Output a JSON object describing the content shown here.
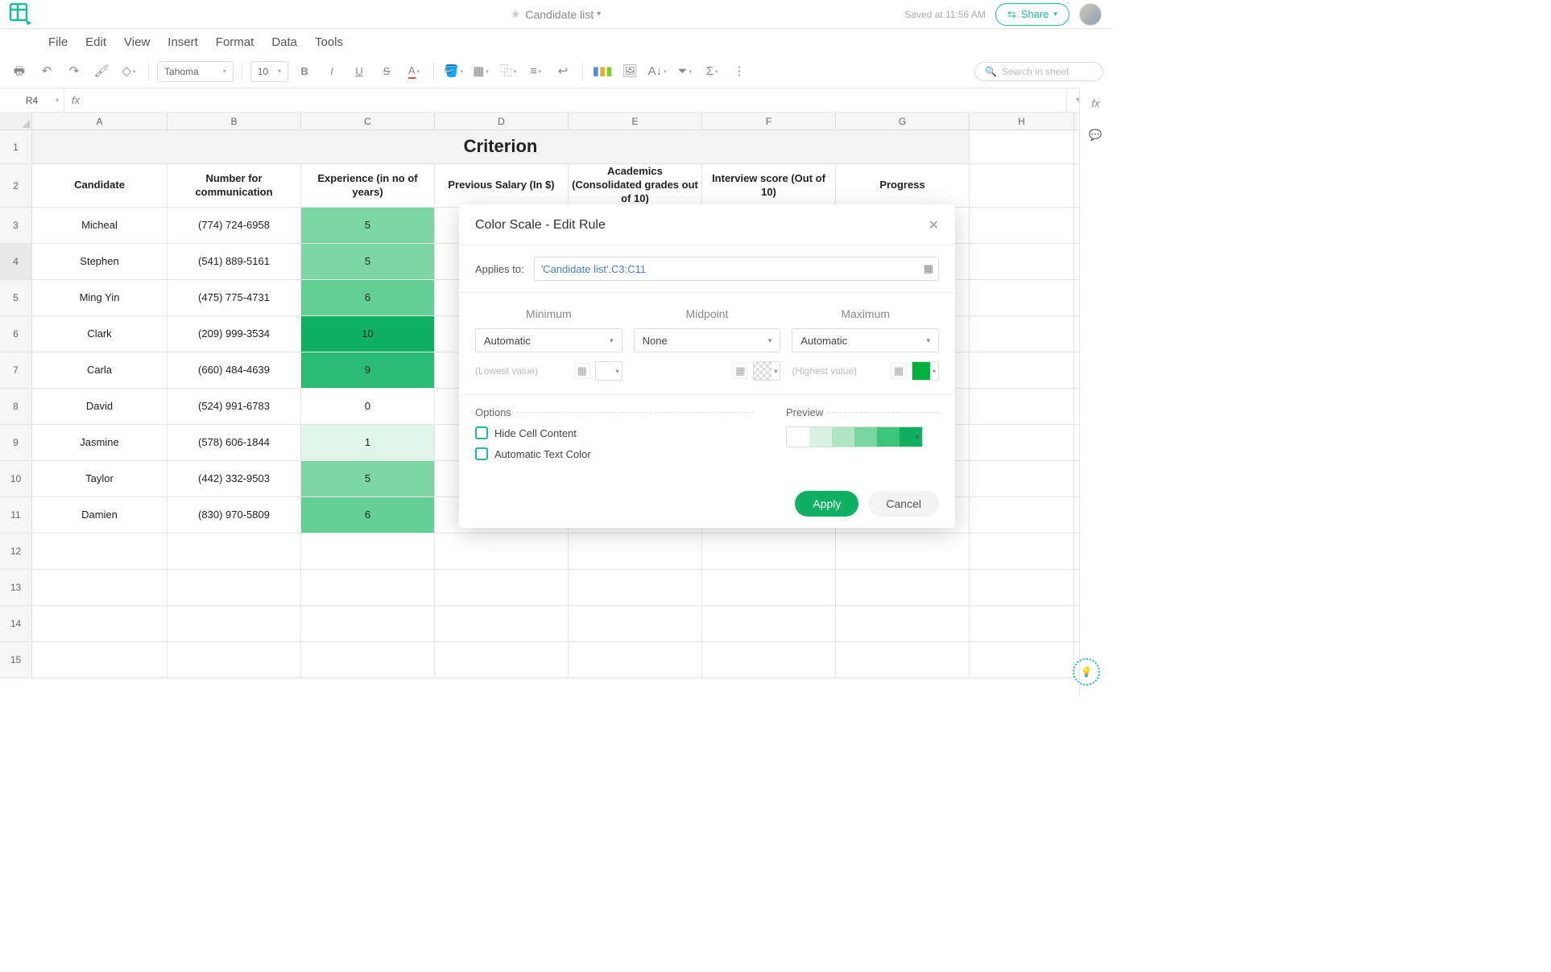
{
  "header": {
    "doc_title": "Candidate list",
    "saved_text": "Saved at 11:56 AM",
    "share_label": "Share"
  },
  "menu": [
    "File",
    "Edit",
    "View",
    "Insert",
    "Format",
    "Data",
    "Tools"
  ],
  "toolbar": {
    "font_family": "Tahoma",
    "font_size": "10",
    "search_placeholder": "Search in sheet"
  },
  "name_box": "R4",
  "columns": [
    "A",
    "B",
    "C",
    "D",
    "E",
    "F",
    "G",
    "H"
  ],
  "col_headers": [
    "Candidate",
    "Number for communication",
    "Experience (in no of years)",
    "Previous Salary (In $)",
    "Academics (Consolidated grades out of 10)",
    "Interview score (Out of 10)",
    "Progress"
  ],
  "title_row": "Criterion",
  "rows": [
    {
      "n": 3,
      "candidate": "Micheal",
      "phone": "(774) 724-6958",
      "exp": "5",
      "exp_color": "#7bd6a3"
    },
    {
      "n": 4,
      "candidate": "Stephen",
      "phone": "(541) 889-5161",
      "exp": "5",
      "exp_color": "#7bd6a3"
    },
    {
      "n": 5,
      "candidate": "Ming Yin",
      "phone": "(475) 775-4731",
      "exp": "6",
      "exp_color": "#64cf94"
    },
    {
      "n": 6,
      "candidate": "Clark",
      "phone": "(209) 999-3534",
      "exp": "10",
      "exp_color": "#0fb061"
    },
    {
      "n": 7,
      "candidate": "Carla",
      "phone": "(660) 484-4639",
      "exp": "9",
      "exp_color": "#2bbc73"
    },
    {
      "n": 8,
      "candidate": "David",
      "phone": "(524) 991-6783",
      "exp": "0",
      "exp_color": "#ffffff"
    },
    {
      "n": 9,
      "candidate": "Jasmine",
      "phone": "(578) 606-1844",
      "exp": "1",
      "exp_color": "#e0f4e9"
    },
    {
      "n": 10,
      "candidate": "Taylor",
      "phone": "(442) 332-9503",
      "exp": "5",
      "exp_color": "#7bd6a3"
    },
    {
      "n": 11,
      "candidate": "Damien",
      "phone": "(830) 970-5809",
      "exp": "6",
      "exp_color": "#64cf94"
    }
  ],
  "empty_rows": [
    12,
    13,
    14,
    15
  ],
  "modal": {
    "title": "Color Scale - Edit Rule",
    "applies_label": "Applies to:",
    "applies_value": "'Candidate list'.C3:C11",
    "min_label": "Minimum",
    "mid_label": "Midpoint",
    "max_label": "Maximum",
    "min_mode": "Automatic",
    "mid_mode": "None",
    "max_mode": "Automatic",
    "min_hint": "(Lowest value)",
    "max_hint": "(Highest value)",
    "options_label": "Options",
    "preview_label": "Preview",
    "hide_label": "Hide Cell Content",
    "auto_text_label": "Automatic Text Color",
    "apply": "Apply",
    "cancel": "Cancel"
  }
}
